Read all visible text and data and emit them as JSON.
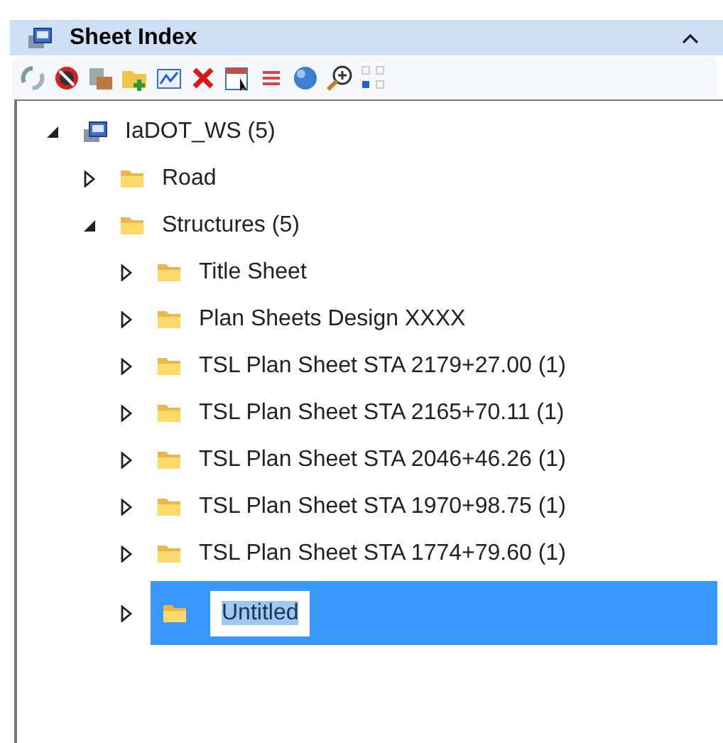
{
  "panel": {
    "title": "Sheet Index",
    "collapsed": false
  },
  "tree": {
    "label": "IaDOT_WS (5)",
    "expanded": true,
    "selected": false,
    "editing": false,
    "children": [
      {
        "label": "Road",
        "expanded": false,
        "selected": false,
        "editing": false
      },
      {
        "label": "Structures (5)",
        "expanded": true,
        "selected": false,
        "editing": false,
        "children": [
          {
            "label": "Title Sheet",
            "expanded": false,
            "selected": false,
            "editing": false
          },
          {
            "label": "Plan Sheets Design XXXX",
            "expanded": false,
            "selected": false,
            "editing": false
          },
          {
            "label": "TSL Plan Sheet STA 2179+27.00 (1)",
            "expanded": false,
            "selected": false,
            "editing": false
          },
          {
            "label": "TSL Plan Sheet STA 2165+70.11 (1)",
            "expanded": false,
            "selected": false,
            "editing": false
          },
          {
            "label": "TSL Plan Sheet STA 2046+46.26 (1)",
            "expanded": false,
            "selected": false,
            "editing": false
          },
          {
            "label": "TSL Plan Sheet STA 1970+98.75 (1)",
            "expanded": false,
            "selected": false,
            "editing": false
          },
          {
            "label": "TSL Plan Sheet STA 1774+79.60 (1)",
            "expanded": false,
            "selected": false,
            "editing": false
          },
          {
            "label": "Untitled",
            "expanded": false,
            "selected": true,
            "editing": true
          }
        ]
      }
    ]
  }
}
